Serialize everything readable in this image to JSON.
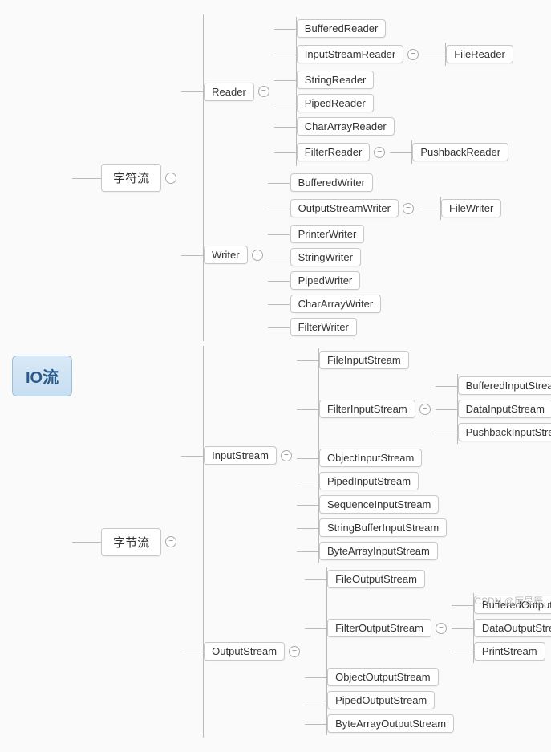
{
  "root": "IO流",
  "watermark": "CSDN @厉昱辰",
  "tree": [
    {
      "label": "字符流",
      "children": [
        {
          "label": "Reader",
          "children": [
            {
              "label": "BufferedReader"
            },
            {
              "label": "InputStreamReader",
              "children": [
                {
                  "label": "FileReader"
                }
              ]
            },
            {
              "label": "StringReader"
            },
            {
              "label": "PipedReader"
            },
            {
              "label": "CharArrayReader"
            },
            {
              "label": "FilterReader",
              "children": [
                {
                  "label": "PushbackReader"
                }
              ]
            }
          ]
        },
        {
          "label": "Writer",
          "children": [
            {
              "label": "BufferedWriter"
            },
            {
              "label": "OutputStreamWriter",
              "children": [
                {
                  "label": "FileWriter"
                }
              ]
            },
            {
              "label": "PrinterWriter"
            },
            {
              "label": "StringWriter"
            },
            {
              "label": "PipedWriter"
            },
            {
              "label": "CharArrayWriter"
            },
            {
              "label": "FilterWriter"
            }
          ]
        }
      ]
    },
    {
      "label": "字节流",
      "children": [
        {
          "label": "InputStream",
          "children": [
            {
              "label": "FileInputStream"
            },
            {
              "label": "FilterInputStream",
              "children": [
                {
                  "label": "BufferedInputStream"
                },
                {
                  "label": "DataInputStream"
                },
                {
                  "label": "PushbackInputStream"
                }
              ]
            },
            {
              "label": "ObjectInputStream"
            },
            {
              "label": "PipedInputStream"
            },
            {
              "label": "SequenceInputStream"
            },
            {
              "label": "StringBufferInputStream"
            },
            {
              "label": "ByteArrayInputStream"
            }
          ]
        },
        {
          "label": "OutputStream",
          "children": [
            {
              "label": "FileOutputStream"
            },
            {
              "label": "FilterOutputStream",
              "children": [
                {
                  "label": "BufferedOutputStream"
                },
                {
                  "label": "DataOutputStream"
                },
                {
                  "label": "PrintStream"
                }
              ]
            },
            {
              "label": "ObjectOutputStream"
            },
            {
              "label": "PipedOutputStream"
            },
            {
              "label": "ByteArrayOutputStream"
            }
          ]
        }
      ]
    }
  ]
}
